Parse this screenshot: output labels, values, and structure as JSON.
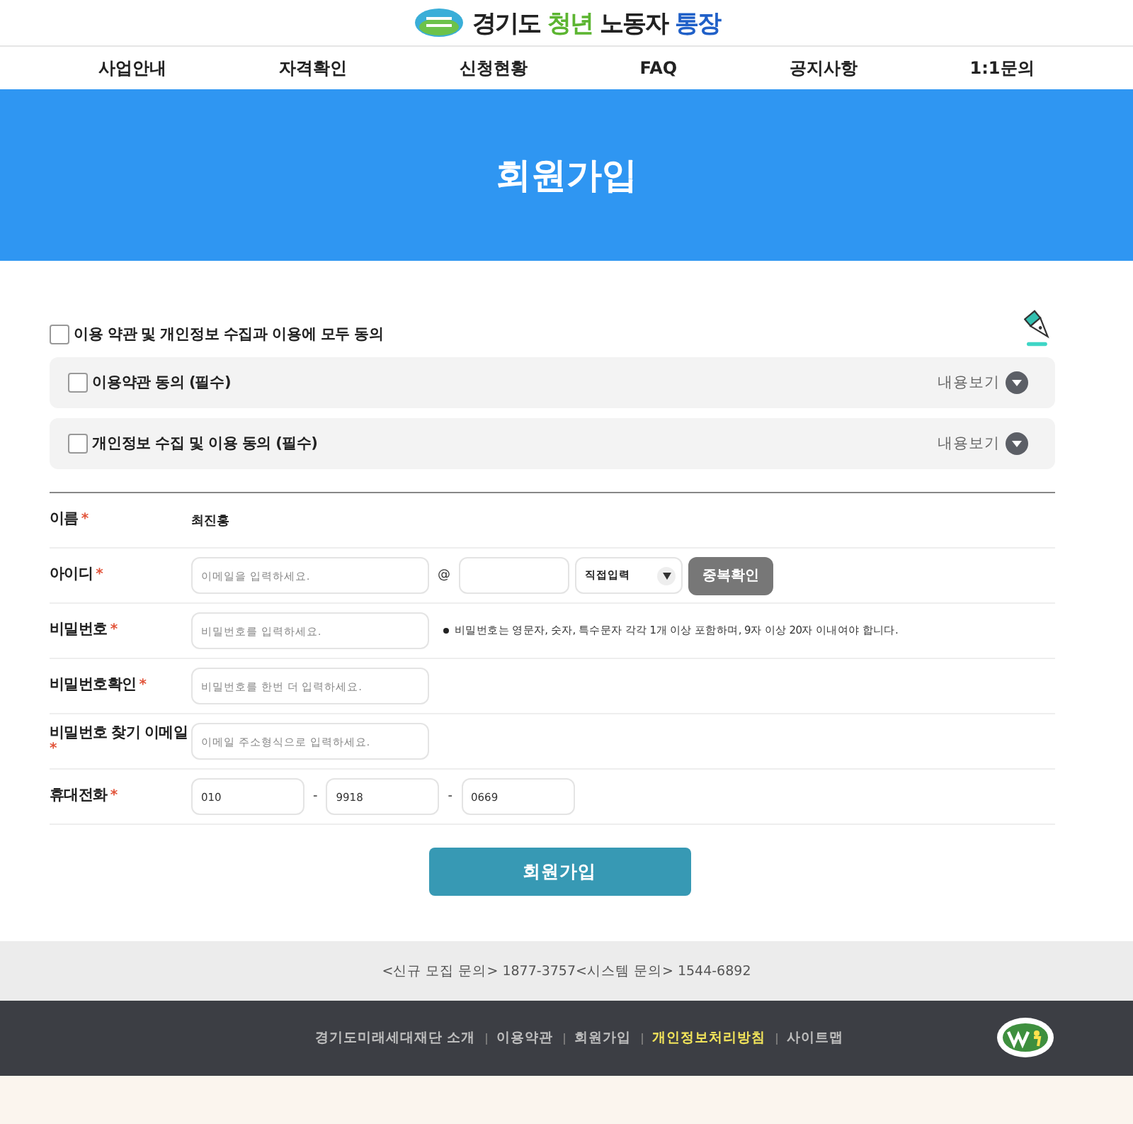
{
  "header": {
    "title": [
      {
        "text": "경기도",
        "color": "#222222"
      },
      {
        "text": "청년",
        "color": "#5cb531"
      },
      {
        "text": "노동자",
        "color": "#222222"
      },
      {
        "text": "통장",
        "color": "#2060c8"
      }
    ]
  },
  "nav": [
    "사업안내",
    "자격확인",
    "신청현황",
    "FAQ",
    "공지사항",
    "1:1문의"
  ],
  "banner": {
    "title": "회원가입"
  },
  "agreement": {
    "all": {
      "label": "이용 약관 및 개인정보 수집과 이용에 모두 동의",
      "checked": false
    },
    "items": [
      {
        "label": "이용약관 동의 (필수)",
        "checked": false,
        "toggle": "내용보기"
      },
      {
        "label": "개인정보 수집 및 이용 동의 (필수)",
        "checked": false,
        "toggle": "내용보기"
      }
    ]
  },
  "form": [
    {
      "kind": "text",
      "label": "이름",
      "mark": "*",
      "value": "최진홍"
    },
    {
      "kind": "email",
      "label": "아이디",
      "mark": "*",
      "placeholder": "이메일을 입력하세요.",
      "at": "@",
      "select": "직접입력",
      "button": "중복확인"
    },
    {
      "kind": "password",
      "label": "비밀번호",
      "mark": "*",
      "placeholder": "비밀번호를 입력하세요.",
      "hint": "비밀번호는 영문자, 숫자, 특수문자 각각 1개 이상 포함하며, 9자 이상 20자 이내여야 합니다."
    },
    {
      "kind": "password",
      "label": "비밀번호확인",
      "mark": "*",
      "placeholder": "비밀번호를 한번 더 입력하세요."
    },
    {
      "kind": "input",
      "label": "비밀번호 찾기 이메일",
      "mark": "*",
      "placeholder": "이메일 주소형식으로 입력하세요."
    },
    {
      "kind": "phone",
      "label": "휴대전화",
      "mark": "*",
      "parts": [
        "010",
        "9918",
        "0669"
      ],
      "sep": "-"
    }
  ],
  "submit": "회원가입",
  "contact": "<신규 모집 문의> 1877-3757<시스템 문의> 1544-6892",
  "footer_links": [
    {
      "label": "경기도미래세대재단 소개",
      "highlighted": false
    },
    {
      "label": "이용약관",
      "highlighted": false
    },
    {
      "label": "회원가입",
      "highlighted": false
    },
    {
      "label": "개인정보처리방침",
      "highlighted": true
    },
    {
      "label": "사이트맵",
      "highlighted": false
    }
  ]
}
